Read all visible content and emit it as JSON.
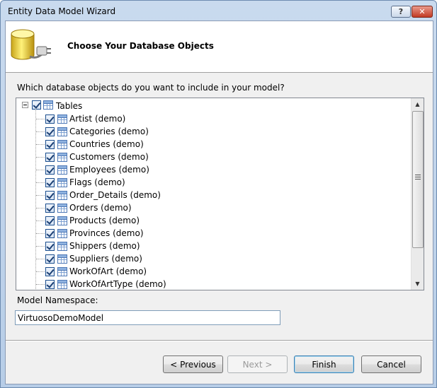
{
  "window": {
    "title": "Entity Data Model Wizard",
    "help_label": "?",
    "close_label": "✕"
  },
  "header": {
    "title": "Choose Your Database Objects",
    "icon": "database-plug-icon"
  },
  "prompt": "Which database objects do you want to include in your model?",
  "tree": {
    "root_label": "Tables",
    "items": [
      "Artist (demo)",
      "Categories (demo)",
      "Countries (demo)",
      "Customers (demo)",
      "Employees (demo)",
      "Flags (demo)",
      "Order_Details (demo)",
      "Orders (demo)",
      "Products (demo)",
      "Provinces (demo)",
      "Shippers (demo)",
      "Suppliers (demo)",
      "WorkOfArt (demo)",
      "WorkOfArtType (demo)"
    ]
  },
  "namespace": {
    "label": "Model Namespace:",
    "value": "VirtuosoDemoModel"
  },
  "buttons": {
    "previous": "< Previous",
    "next": "Next >",
    "finish": "Finish",
    "cancel": "Cancel"
  }
}
